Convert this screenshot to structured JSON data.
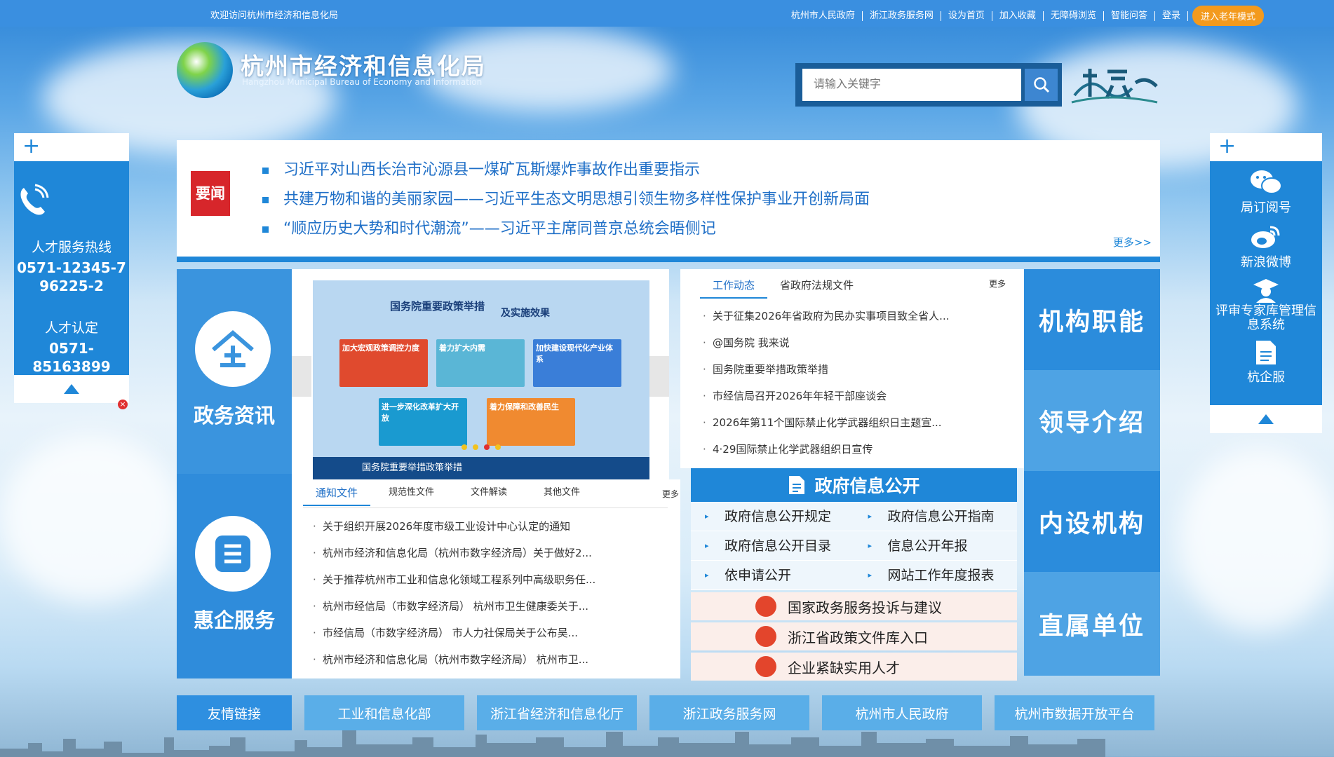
{
  "topbar": {
    "welcome": "欢迎访问杭州市经济和信息化局",
    "links": [
      "杭州市人民政府",
      "浙江政务服务网",
      "设为首页",
      "加入收藏",
      "无障碍浏览",
      "智能问答",
      "登录"
    ],
    "elder_button": "进入老年模式"
  },
  "header": {
    "title": "杭州市经济和信息化局",
    "subtitle": "Hangzhou Municipal Bureau of Economy and Information",
    "search_placeholder": "请输入关键字"
  },
  "left_float": {
    "hotline_label": "人才服务热线",
    "hotline_number_1": "0571-12345-7",
    "hotline_number_2": "96225-2",
    "cert_label": "人才认定",
    "cert_number": "0571-85163899",
    "close": "×"
  },
  "right_float": {
    "items": [
      {
        "label": "局订阅号",
        "icon": "wechat-icon"
      },
      {
        "label": "新浪微博",
        "icon": "weibo-icon"
      },
      {
        "label": "评审专家库管理信息系统",
        "icon": "expert-icon"
      },
      {
        "label": "杭企服",
        "icon": "document-icon"
      }
    ]
  },
  "headline_news": {
    "badge": "要闻",
    "items": [
      "习近平对山西长治市沁源县一煤矿瓦斯爆炸事故作出重要指示",
      "共建万物和谐的美丽家园——习近平生态文明思想引领生物多样性保护事业开创新局面",
      "“顺应历史大势和时代潮流”——习近平主席同普京总统会晤侧记"
    ],
    "more": "更多>>"
  },
  "left_tiles": {
    "gov_info": "政务资讯",
    "enterprise_service": "惠企服务"
  },
  "right_tiles": {
    "t1": "机构职能",
    "t2": "领导介绍",
    "t3": "内设机构",
    "t4": "直属单位"
  },
  "carousel": {
    "banner_title": "国务院重要政策举措",
    "banner_sub": "及实施效果",
    "tiles": [
      "加大宏观政策调控力度",
      "着力扩大内需",
      "加快建设现代化产业体系",
      "进一步深化改革扩大开放",
      "着力保障和改善民生"
    ],
    "caption": "国务院重要举措政策举措"
  },
  "notice_panel": {
    "tabs": [
      "通知文件",
      "规范性文件",
      "文件解读",
      "其他文件"
    ],
    "more": "更多",
    "items": [
      "关于组织开展2026年度市级工业设计中心认定的通知",
      "杭州市经济和信息化局（杭州市数字经济局）关于做好2...",
      "关于推荐杭州市工业和信息化领域工程系列中高级职务任...",
      "杭州市经信局（市数字经济局） 杭州市卫生健康委关于...",
      "市经信局（市数字经济局） 市人力社保局关于公布吴...",
      "杭州市经济和信息化局（杭州市数字经济局） 杭州市卫..."
    ]
  },
  "work_panel": {
    "tabs": [
      "工作动态",
      "省政府法规文件"
    ],
    "more": "更多",
    "items": [
      "关于征集2026年省政府为民办实事项目致全省人...",
      "@国务院 我来说",
      "国务院重要举措政策举措",
      "市经信局召开2026年年轻干部座谈会",
      "2026年第11个国际禁止化学武器组织日主题宣...",
      "4·29国际禁止化学武器组织日宣传"
    ]
  },
  "gov_open": {
    "title": "政府信息公开",
    "rows": [
      [
        "政府信息公开规定",
        "政府信息公开指南"
      ],
      [
        "政府信息公开目录",
        "信息公开年报"
      ],
      [
        "依申请公开",
        "网站工作年度报表"
      ]
    ],
    "services": [
      "国家政务服务投诉与建议",
      "浙江省政策文件库入口",
      "企业紧缺实用人才"
    ]
  },
  "footer_links": [
    "友情链接",
    "工业和信息化部",
    "浙江省经济和信息化厅",
    "浙江政务服务网",
    "杭州市人民政府",
    "杭州市数据开放平台"
  ],
  "colors": {
    "primary": "#1f87d8",
    "topbar": "#3a8fe0",
    "elder": "#f39a1d",
    "badge": "#d7262b",
    "service_icon": "#e3452c"
  }
}
